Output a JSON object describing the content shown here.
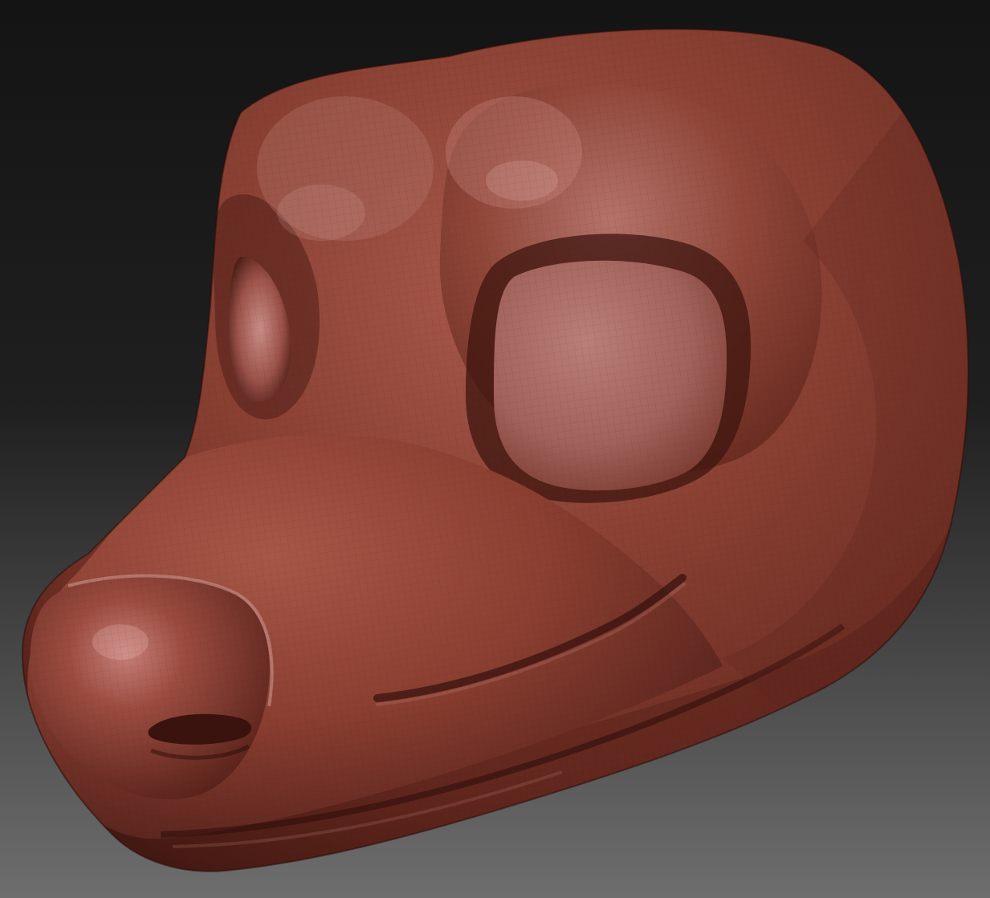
{
  "viewport": {
    "background_top": "#141414",
    "background_bottom": "#6e6e6e"
  },
  "model": {
    "subject": "sculpted-animal-head",
    "material_color": "#8a3f32",
    "material_highlight": "#c07a72",
    "material_shadow": "#3a1712",
    "wireframe_visible": true
  }
}
